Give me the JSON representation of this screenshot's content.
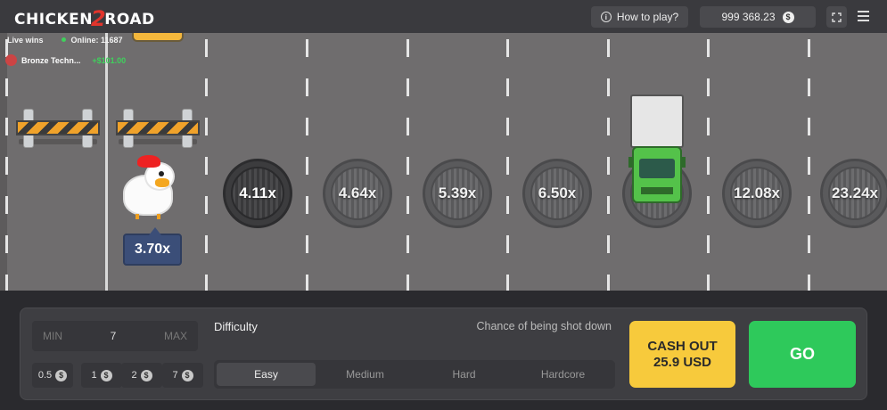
{
  "header": {
    "logo_left": "CHICKEN",
    "logo_num": "2",
    "logo_right": "ROAD",
    "how_to_play": "How to play?",
    "info_glyph": "i",
    "balance": "999 368.23",
    "currency_glyph": "$"
  },
  "live": {
    "label": "Live wins",
    "online": "Online: 11687",
    "win": {
      "name": "Bronze Techn...",
      "amount": "+$101.00"
    }
  },
  "game": {
    "current_multiplier": "3.70x",
    "multipliers": [
      "4.11x",
      "4.64x",
      "5.39x",
      "6.50x",
      "12.08x",
      "23.24x"
    ]
  },
  "controls": {
    "min_label": "MIN",
    "bet_value": "7",
    "max_label": "MAX",
    "chips": [
      "0.5",
      "1",
      "2",
      "7"
    ],
    "difficulty_label": "Difficulty",
    "chance_label": "Chance of being shot down",
    "difficulties": [
      "Easy",
      "Medium",
      "Hard",
      "Hardcore"
    ],
    "active_difficulty": "Easy",
    "cashout_line1": "CASH OUT",
    "cashout_line2": "25.9 USD",
    "go_label": "GO"
  },
  "colors": {
    "road": "#6f6d6e",
    "cashout": "#f7ca3c",
    "go": "#2ec95b",
    "bubble": "#3b4e78"
  }
}
